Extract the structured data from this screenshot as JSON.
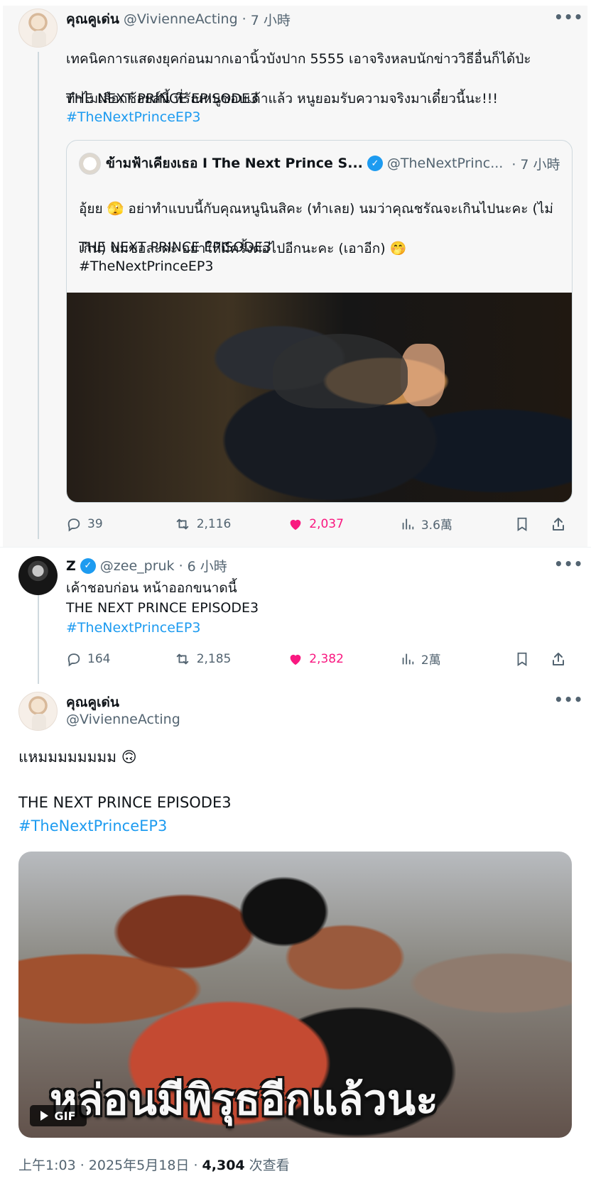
{
  "tweet1": {
    "name": "คุณคูเด่น",
    "handle": "@VivienneActing",
    "separator": "·",
    "time": "7 小時",
    "text_line1": "เทคนิคการแสดงยุคก่อนมากเอานิ้วบังปาก 5555 เอาจริงหลบนักข่าววิธีอื่นก็ได้ป่ะ",
    "text_line2": "ทำไมเลือกช้อยส์นี้ พี่รัณหนูชอบเค้าแล้ว หนูยอมรับความจริงมาเดี๋ยวนี้นะ!!!",
    "episode": "THE NEXT PRINCE EPISODE3",
    "hashtag": "#TheNextPrinceEP3",
    "stats": {
      "replies": "39",
      "reposts": "2,116",
      "likes": "2,037",
      "views": "3.6萬"
    }
  },
  "quote": {
    "name": "ข้ามฟ้าเคียงเธอ I The Next Prince S...",
    "handle": "@TheNextPrinc...",
    "time": "· 7 小時",
    "text_line1": "อุ้ยย 🫣 อย่าทำแบบนี้กับคุณหนูนินสิคะ (ทำเลย) นมว่าคุณชรัณจะเกินไปนะคะ (ไม่",
    "text_line2": "เกิน) นมขอละค่ะ อย่าให้มีครั้งต่อไปอีกนะคะ (เอาอีก) 🤭",
    "episode": "THE NEXT PRINCE EPISODE3",
    "hashtag": "#TheNextPrinceEP3"
  },
  "tweet2": {
    "name": "Z",
    "handle": "@zee_pruk",
    "separator": "·",
    "time": "6 小時",
    "text_line1": "เค้าชอบก่อน หน้าออกขนาดนี้",
    "episode": "THE NEXT PRINCE EPISODE3",
    "hashtag": "#TheNextPrinceEP3",
    "stats": {
      "replies": "164",
      "reposts": "2,185",
      "likes": "2,382",
      "views": "2萬"
    }
  },
  "main": {
    "name": "คุณคูเด่น",
    "handle": "@VivienneActing",
    "text": "แหมมมมมมมม 🙃",
    "episode": "THE NEXT PRINCE EPISODE3",
    "hashtag": "#TheNextPrinceEP3",
    "gif_caption": "หล่อนมีพิรุธอีกแล้วนะ",
    "gif_badge": "GIF",
    "time_date": "上午1:03 · 2025年5月18日 · ",
    "views_count": "4,304",
    "views_label": " 次查看"
  },
  "icons": [
    "more-icon",
    "reply-icon",
    "repost-icon",
    "like-icon",
    "views-icon",
    "bookmark-icon",
    "share-icon",
    "verified-icon",
    "play-icon"
  ],
  "colors": {
    "link": "#1d9bf0",
    "like": "#f91880",
    "muted": "#536471",
    "thread_bg": "#f7f7f7"
  }
}
